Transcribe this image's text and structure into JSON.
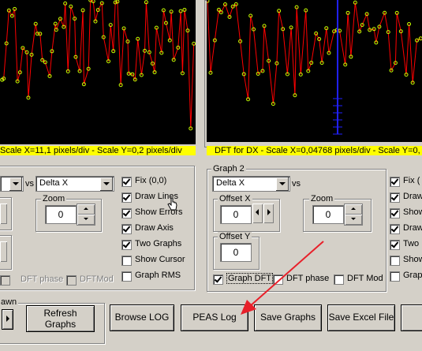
{
  "left_panel": {
    "caption": "Scale X=11,1 pixels/div - Scale Y=0,2 pixels/div",
    "vs_label": "vs",
    "x_combo": "Delta X",
    "zoom_title": "Zoom",
    "zoom_value": "0",
    "checkboxes": [
      {
        "label": "Fix (0,0)",
        "checked": true
      },
      {
        "label": "Draw Lines",
        "checked": true
      },
      {
        "label": "Show Errors",
        "checked": true
      },
      {
        "label": "Draw Axis",
        "checked": true
      },
      {
        "label": "Two Graphs",
        "checked": true
      },
      {
        "label": "Show Cursor",
        "checked": false
      },
      {
        "label": "Graph RMS",
        "checked": false
      }
    ],
    "dft_phase": "DFT phase",
    "dft_mod": "DFTMod",
    "bottom_group_title": "awn"
  },
  "right_panel": {
    "caption": "DFT for DX - Scale X=0,04768 pixels/div - Scale Y=0,",
    "group_title": "Graph 2",
    "y_combo": "Delta X",
    "vs_label": "vs",
    "offset_x_title": "Offset X",
    "offset_x_value": "0",
    "offset_y_title": "Offset Y",
    "offset_y_value": "0",
    "zoom_title": "Zoom",
    "zoom_value": "0",
    "graph_dft": "Graph DFT",
    "dft_phase": "DFT phase",
    "dft_mod": "DFT Mod",
    "checkboxes": [
      {
        "label": "Fix (",
        "checked": true
      },
      {
        "label": "Draw",
        "checked": true
      },
      {
        "label": "Show",
        "checked": true
      },
      {
        "label": "Draw",
        "checked": true
      },
      {
        "label": "Two",
        "checked": true
      },
      {
        "label": "Show",
        "checked": false
      },
      {
        "label": "Grap",
        "checked": false
      }
    ]
  },
  "buttons": {
    "refresh_line1": "Refresh",
    "refresh_line2": "Graphs",
    "browse_log": "Browse LOG",
    "peas_log": "PEAS Log",
    "save_graphs": "Save Graphs",
    "save_excel": "Save Excel File"
  },
  "colors": {
    "plot_bg": "#000000",
    "series": "#ff0000",
    "points": "#c8ff00",
    "caption_bg": "#ffff00",
    "annotation_arrow": "#e8202a",
    "highlight_line": "#2020ff"
  }
}
